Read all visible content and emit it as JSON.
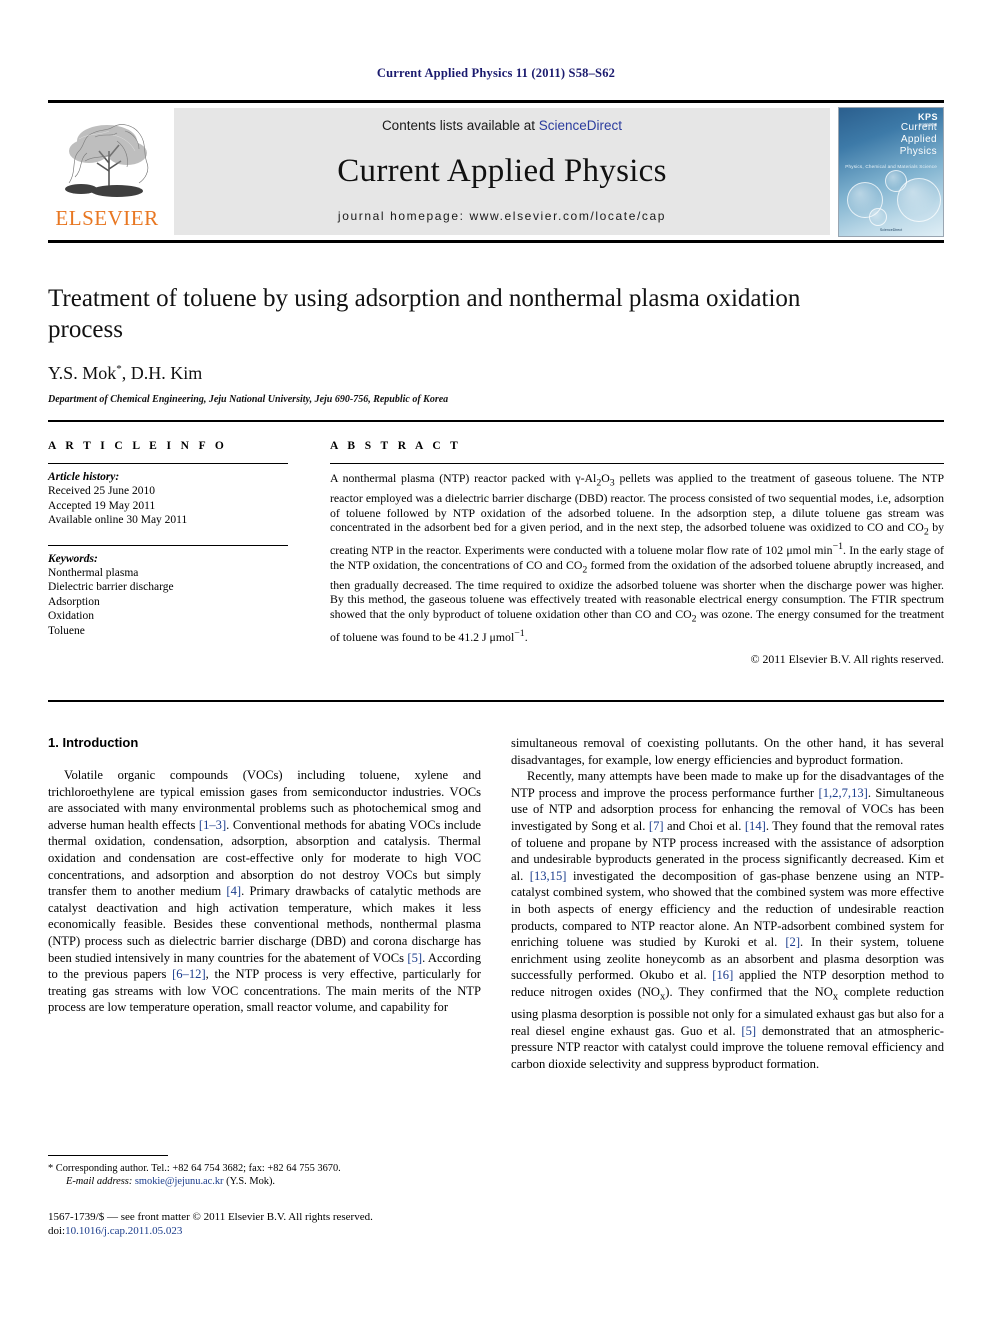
{
  "running_head": "Current Applied Physics 11 (2011) S58–S62",
  "banner": {
    "publisher_name": "ELSEVIER",
    "contents_prefix": "Contents lists available at ",
    "contents_link": "ScienceDirect",
    "journal_title": "Current Applied Physics",
    "homepage": "journal homepage: www.elsevier.com/locate/cap",
    "cover": {
      "line1": "Current",
      "line2": "Applied",
      "line3": "Physics",
      "subtitle": "Physics, Chemical and Materials Science",
      "badge": "KPS",
      "badge_sub": "한국물리학회",
      "footer": "ScienceDirect"
    }
  },
  "article": {
    "title": "Treatment of toluene by using adsorption and nonthermal plasma oxidation process",
    "authors": "Y.S. Mok",
    "authors_rest": ", D.H. Kim",
    "author_marker": "*",
    "affiliation": "Department of Chemical Engineering, Jeju National University, Jeju 690-756, Republic of Korea"
  },
  "info": {
    "label": "A R T I C L E  I N F O",
    "history_heading": "Article history:",
    "history": [
      "Received 25 June 2010",
      "Accepted 19 May 2011",
      "Available online 30 May 2011"
    ],
    "keywords_heading": "Keywords:",
    "keywords": [
      "Nonthermal plasma",
      "Dielectric barrier discharge",
      "Adsorption",
      "Oxidation",
      "Toluene"
    ]
  },
  "abstract": {
    "label": "A B S T R A C T",
    "text_part1": "A nonthermal plasma (NTP) reactor packed with ",
    "gamma_alumina": "γ-Al",
    "text_part2": " pellets was applied to the treatment of gaseous toluene. The NTP reactor employed was a dielectric barrier discharge (DBD) reactor. The process consisted of two sequential modes, i.e, adsorption of toluene followed by NTP oxidation of the adsorbed toluene. In the adsorption step, a dilute toluene gas stream was concentrated in the adsorbent bed for a given period, and in the next step, the adsorbed toluene was oxidized to CO and CO",
    "text_part3": " by creating NTP in the reactor. Experiments were conducted with a toluene molar flow rate of 102 μmol min",
    "text_part4": ". In the early stage of the NTP oxidation, the concentrations of CO and CO",
    "text_part5": " formed from the oxidation of the adsorbed toluene abruptly increased, and then gradually decreased. The time required to oxidize the adsorbed toluene was shorter when the discharge power was higher. By this method, the gaseous toluene was effectively treated with reasonable electrical energy consumption. The FTIR spectrum showed that the only byproduct of toluene oxidation other than CO and CO",
    "text_part6": " was ozone. The energy consumed for the treatment of toluene was found to be 41.2 J μmol",
    "text_part7": ".",
    "copyright": "© 2011 Elsevier B.V. All rights reserved."
  },
  "introduction": {
    "heading": "1.  Introduction",
    "left_p1_a": "Volatile organic compounds (VOCs) including toluene, xylene and trichloroethylene are typical emission gases from semiconductor industries. VOCs are associated with many environmental problems such as photochemical smog and adverse human health effects ",
    "left_cite1": "[1–3]",
    "left_p1_b": ". Conventional methods for abating VOCs include thermal oxidation, condensation, adsorption, absorption and catalysis. Thermal oxidation and condensation are cost-effective only for moderate to high VOC concentrations, and adsorption and absorption do not destroy VOCs but simply transfer them to another medium ",
    "left_cite2": "[4]",
    "left_p1_c": ". Primary drawbacks of catalytic methods are catalyst deactivation and high activation temperature, which makes it less economically feasible. Besides these conventional methods, nonthermal plasma (NTP) process such as dielectric barrier discharge (DBD) and corona discharge has been studied intensively in many countries for the abatement of VOCs ",
    "left_cite3": "[5]",
    "left_p1_d": ". According to the previous papers ",
    "left_cite4": "[6–12]",
    "left_p1_e": ", the NTP process is very effective, particularly for treating gas streams with low VOC concentrations. The main merits of the NTP process are low temperature operation, small reactor volume, and capability for",
    "right_p1_a": "simultaneous removal of coexisting pollutants. On the other hand, it has several disadvantages, for example, low energy efficiencies and byproduct formation.",
    "right_p2_a": "Recently, many attempts have been made to make up for the disadvantages of the NTP process and improve the process performance further ",
    "right_cite1": "[1,2,7,13]",
    "right_p2_b": ". Simultaneous use of NTP and adsorption process for enhancing the removal of VOCs has been investigated by Song et al. ",
    "right_cite2": "[7]",
    "right_p2_c": " and Choi et al. ",
    "right_cite3": "[14]",
    "right_p2_d": ". They found that the removal rates of toluene and propane by NTP process increased with the assistance of adsorption and undesirable byproducts generated in the process significantly decreased. Kim et al. ",
    "right_cite4": "[13,15]",
    "right_p2_e": " investigated the decomposition of gas-phase benzene using an NTP-catalyst combined system, who showed that the combined system was more effective in both aspects of energy efficiency and the reduction of undesirable reaction products, compared to NTP reactor alone. An NTP-adsorbent combined system for enriching toluene was studied by Kuroki et al. ",
    "right_cite5": "[2]",
    "right_p2_f": ". In their system, toluene enrichment using zeolite honeycomb as an absorbent and plasma desorption was successfully performed. Okubo et al. ",
    "right_cite6": "[16]",
    "right_p2_g": " applied the NTP desorption method to reduce nitrogen oxides (NO",
    "right_p2_h": "). They confirmed that the NO",
    "right_p2_i": " complete reduction using plasma desorption is possible not only for a simulated exhaust gas but also for a real diesel engine exhaust gas. Guo et al. ",
    "right_cite7": "[5]",
    "right_p2_j": " demonstrated that an atmospheric-pressure NTP reactor with catalyst could improve the toluene removal efficiency and carbon dioxide selectivity and suppress byproduct formation."
  },
  "footnote": {
    "marker": "*",
    "corresponding": " Corresponding author. Tel.: +82 64 754 3682; fax: +82 64 755 3670.",
    "email_label": "E-mail address:",
    "email": "smokie@jejunu.ac.kr",
    "email_attrib": " (Y.S. Mok)."
  },
  "footer": {
    "issn_line": "1567-1739/$ — see front matter © 2011 Elsevier B.V. All rights reserved.",
    "doi_label": "doi:",
    "doi_value": "10.1016/j.cap.2011.05.023"
  },
  "colors": {
    "link": "#1a3c8c",
    "elsevier_orange": "#e87722",
    "running_head": "#1a1a6e",
    "banner_grey": "#e6e6e6"
  }
}
